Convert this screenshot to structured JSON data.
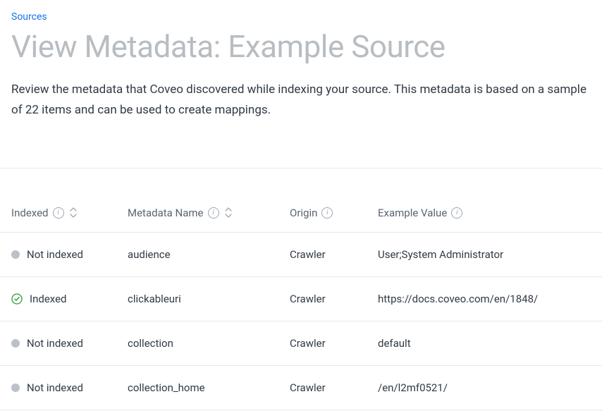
{
  "breadcrumb": {
    "label": "Sources"
  },
  "page_title": "View Metadata: Example Source",
  "description": "Review the metadata that Coveo discovered while indexing your source. This metadata is based on a sample of 22 items and can be used to create mappings.",
  "columns": {
    "indexed": "Indexed",
    "metadata_name": "Metadata Name",
    "origin": "Origin",
    "example_value": "Example Value"
  },
  "rows": [
    {
      "status": "Not indexed",
      "indexed": false,
      "name": "audience",
      "origin": "Crawler",
      "example": "User;System Administrator"
    },
    {
      "status": "Indexed",
      "indexed": true,
      "name": "clickableuri",
      "origin": "Crawler",
      "example": "https://docs.coveo.com/en/1848/"
    },
    {
      "status": "Not indexed",
      "indexed": false,
      "name": "collection",
      "origin": "Crawler",
      "example": "default"
    },
    {
      "status": "Not indexed",
      "indexed": false,
      "name": "collection_home",
      "origin": "Crawler",
      "example": "/en/l2mf0521/"
    }
  ]
}
